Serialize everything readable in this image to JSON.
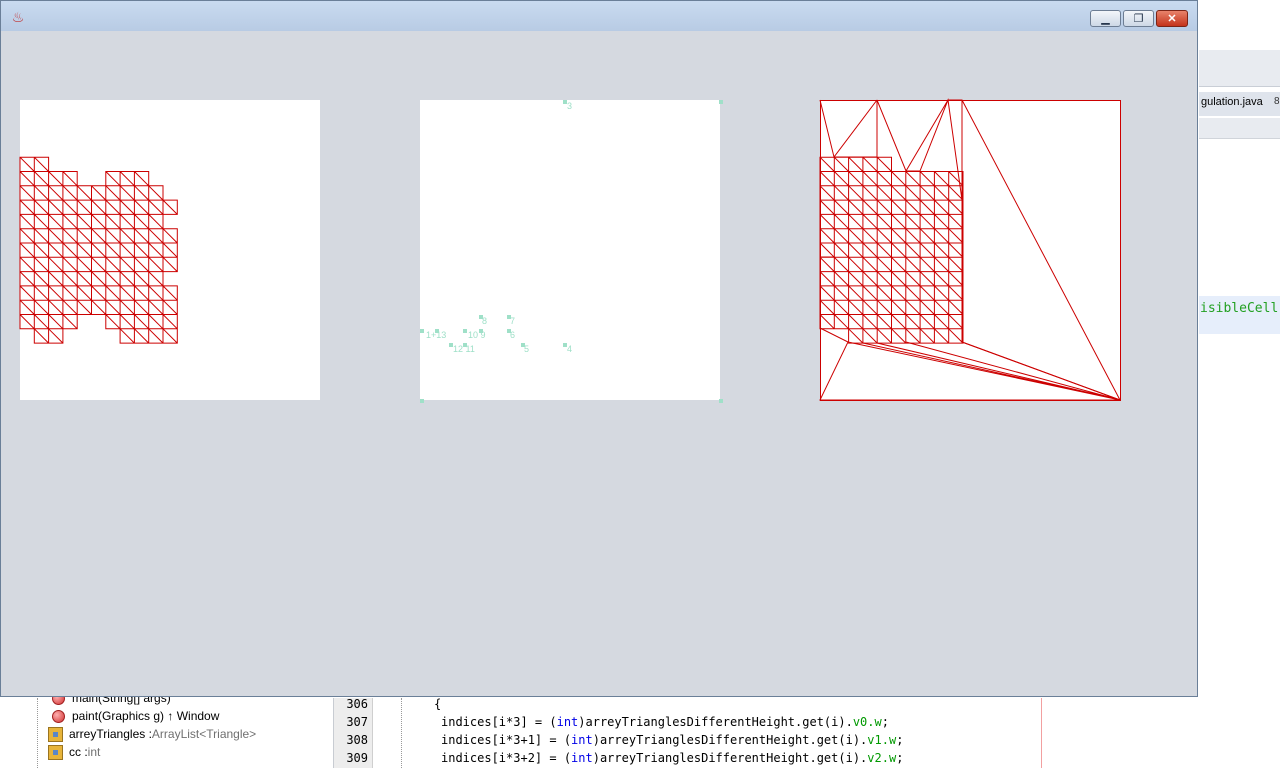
{
  "ide": {
    "right_tab_label": "gulation.java",
    "right_tab_close": "8",
    "right_code_fragment": "isibleCell",
    "navigator_items": [
      {
        "kind": "method",
        "name": "main(String[] args)",
        "type": ""
      },
      {
        "kind": "method",
        "name": "paint(Graphics g) ↑ Window",
        "type": ""
      },
      {
        "kind": "field",
        "name": "arreyTriangles : ",
        "type": "ArrayList<Triangle>"
      },
      {
        "kind": "field",
        "name": "cc : ",
        "type": "int"
      }
    ],
    "line_numbers": [
      "306",
      "307",
      "308",
      "309"
    ],
    "code": {
      "open_brace": "{",
      "l307_a": "indices[i*3] = (",
      "l307_kw": "int",
      "l307_b": ")arreyTrianglesDifferentHeight.get(i).",
      "l307_f": "v0.w",
      "l307_c": ";",
      "l308_a": "indices[i*3+1] = (",
      "l308_kw": "int",
      "l308_b": ")arreyTrianglesDifferentHeight.get(i).",
      "l308_f": "v1.w",
      "l308_c": ";",
      "l309_a": "indices[i*3+2] = (",
      "l309_kw": "int",
      "l309_b": ")arreyTrianglesDifferentHeight.get(i).",
      "l309_f": "v2.w",
      "l309_c": ";"
    }
  },
  "window": {
    "title": "",
    "icon": "java-cup-icon",
    "minimize": "▁",
    "maximize": "❐",
    "close": "✕"
  },
  "colors": {
    "mesh": "#cc0000",
    "points": "#9fe0c8",
    "window_bg": "#d5d9e0"
  },
  "middle_panel_labels": [
    "3",
    "1+13",
    "10 9",
    "12 11",
    "8",
    "7",
    "6",
    "5",
    "4"
  ]
}
